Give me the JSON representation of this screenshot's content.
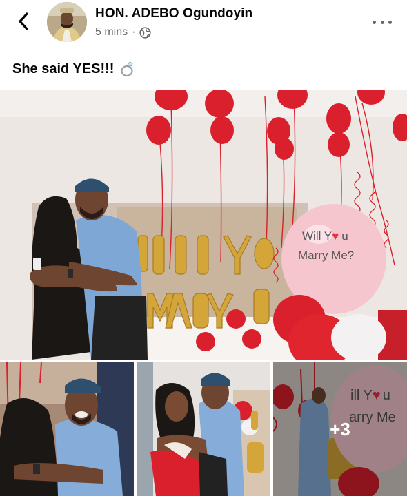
{
  "post": {
    "author": "HON. ADEBO Ogundoyin",
    "time": "5 mins",
    "separator": "·",
    "audience_icon": "globe-icon",
    "caption": "She said YES!!!",
    "caption_emoji": "ring-icon"
  },
  "header": {
    "back_icon": "chevron-left-icon",
    "more_icon": "more-horizontal-icon"
  },
  "photos": {
    "main": {
      "balloon_line1": "Will Y",
      "balloon_heart": "♥",
      "balloon_line1_end": "u",
      "balloon_line2": "Marry Me?",
      "letters_row1": "WILL YOU",
      "letters_row2": "MARRY ME"
    },
    "thumb3": {
      "balloon_line1": "ill Y",
      "balloon_heart": "♥",
      "balloon_line1_end": "u",
      "balloon_line2": "arry Me"
    },
    "more_count": "+3"
  },
  "colors": {
    "balloon_red": "#d9202c",
    "balloon_pink": "#f6c6cf",
    "gold": "#d4a63a",
    "meta_gray": "#65676b"
  }
}
